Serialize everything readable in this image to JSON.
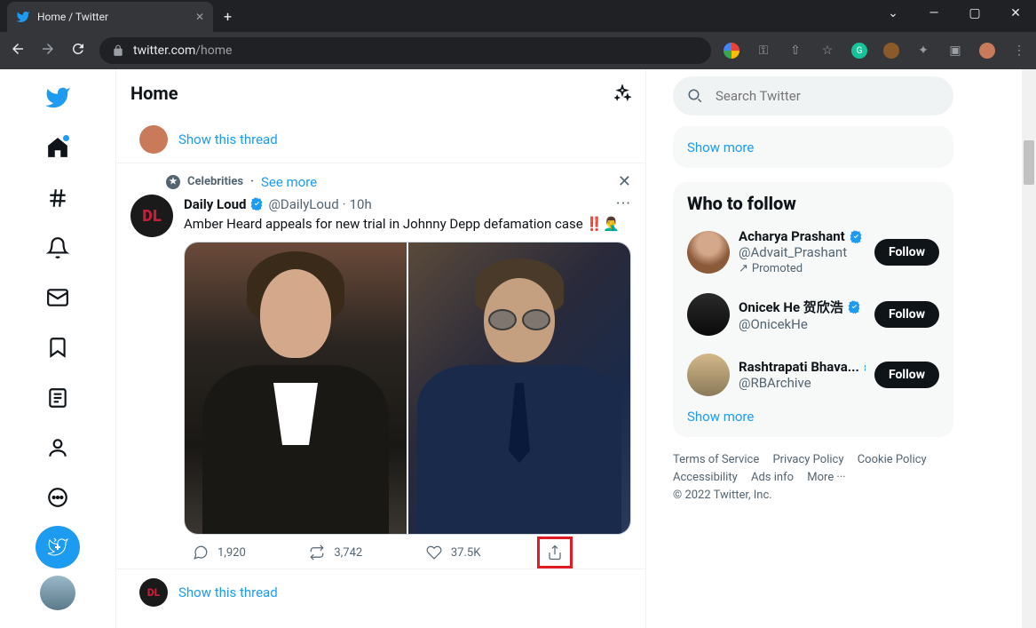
{
  "browser": {
    "tab_title": "Home / Twitter",
    "url_host": "twitter.com",
    "url_path": "/home"
  },
  "header": {
    "title": "Home"
  },
  "thread_prompt": "Show this thread",
  "topic": {
    "label": "Celebrities",
    "see_more": "See more"
  },
  "tweet": {
    "author": "Daily Loud",
    "handle": "@DailyLoud",
    "time": "10h",
    "text": "Amber Heard appeals for new trial in Johnny Depp defamation case ‼️🤦‍♂️",
    "avatar_initials": "DL",
    "replies": "1,920",
    "retweets": "3,742",
    "likes": "37.5K"
  },
  "search": {
    "placeholder": "Search Twitter"
  },
  "trends": {
    "show_more": "Show more"
  },
  "wtf": {
    "title": "Who to follow",
    "items": [
      {
        "name": "Acharya Prashant",
        "handle": "@Advait_Prashant",
        "promoted": "Promoted"
      },
      {
        "name": "Onicek He 贺欣浩",
        "handle": "@OnicekHe"
      },
      {
        "name": "Rashtrapati Bhava...",
        "handle": "@RBArchive"
      }
    ],
    "follow_label": "Follow",
    "show_more": "Show more"
  },
  "footer": {
    "terms": "Terms of Service",
    "privacy": "Privacy Policy",
    "cookies": "Cookie Policy",
    "accessibility": "Accessibility",
    "ads": "Ads info",
    "more": "More ···",
    "copyright": "© 2022 Twitter, Inc."
  }
}
